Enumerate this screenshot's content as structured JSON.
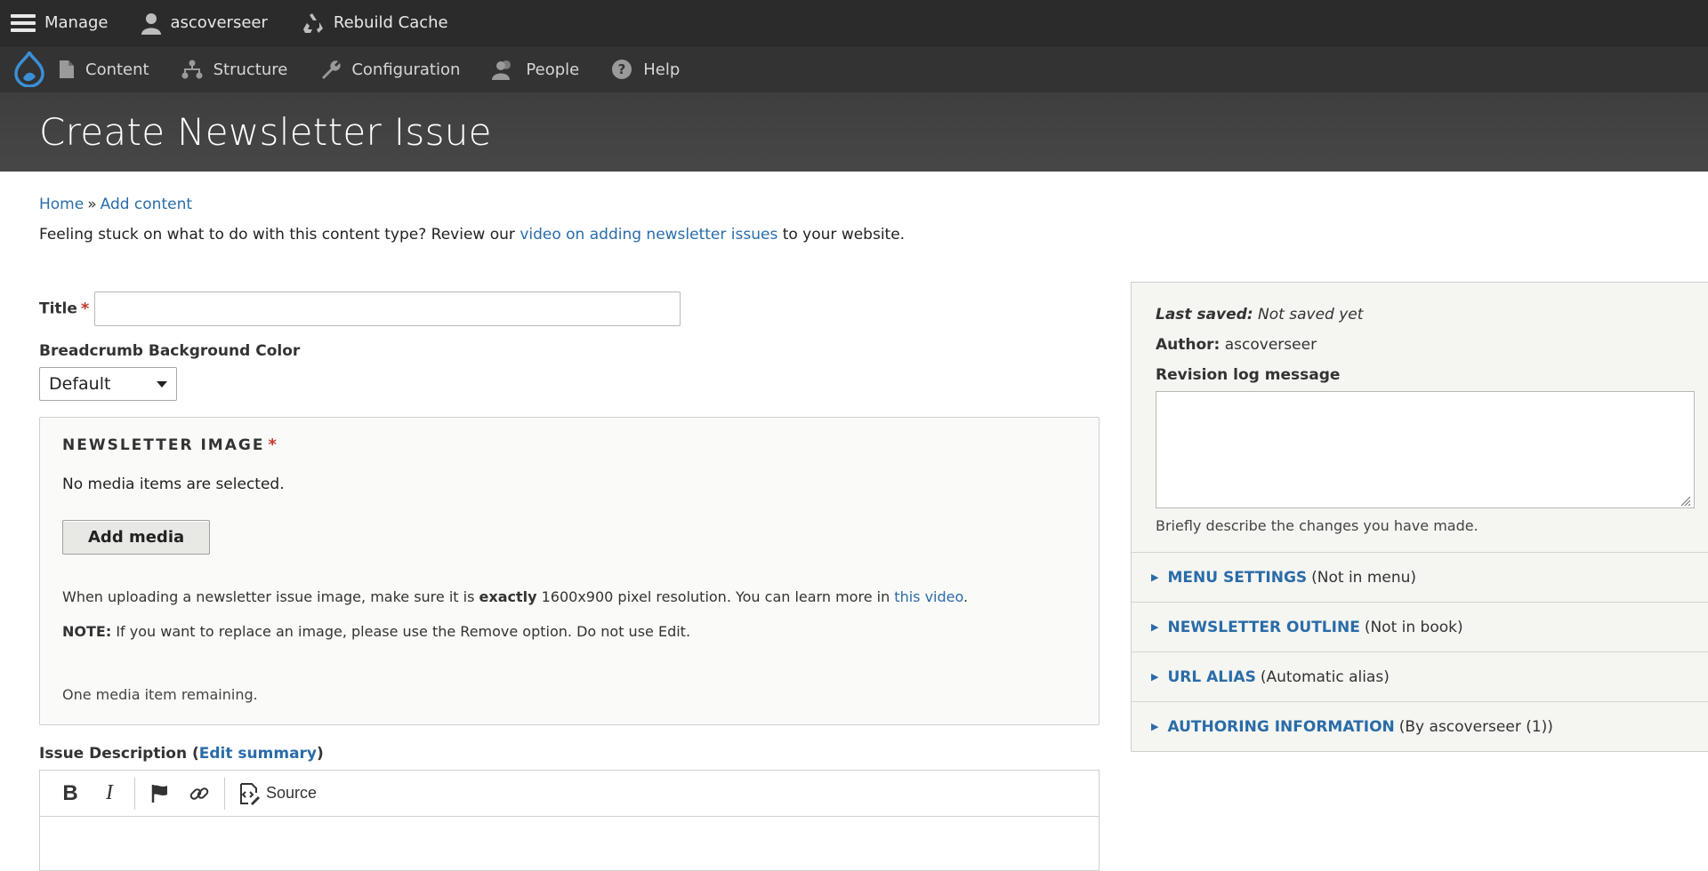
{
  "toolbar": {
    "manage": "Manage",
    "user": "ascoverseer",
    "rebuild": "Rebuild Cache"
  },
  "admin_menu": {
    "items": [
      {
        "label": "Content",
        "icon": "file-icon"
      },
      {
        "label": "Structure",
        "icon": "sitemap-icon"
      },
      {
        "label": "Configuration",
        "icon": "wrench-icon"
      },
      {
        "label": "People",
        "icon": "people-icon"
      },
      {
        "label": "Help",
        "icon": "help-icon"
      }
    ]
  },
  "page": {
    "title": "Create Newsletter Issue"
  },
  "breadcrumb": {
    "home": "Home",
    "sep": "»",
    "add_content": "Add content"
  },
  "help": {
    "before": "Feeling stuck on what to do with this content type? Review our ",
    "link": "video on adding newsletter issues",
    "after": " to your website."
  },
  "form": {
    "title_label": "Title",
    "required_mark": "*",
    "title_value": "",
    "bg_color_label": "Breadcrumb Background Color",
    "bg_color_value": "Default",
    "newsletter_image": {
      "legend": "NEWSLETTER IMAGE",
      "empty_text": "No media items are selected.",
      "add_button": "Add media",
      "desc_before": "When uploading a newsletter issue image, make sure it is ",
      "desc_bold": "exactly",
      "desc_after": " 1600x900 pixel resolution. You can learn more in ",
      "desc_link": "this video",
      "desc_end": ".",
      "note_label": "NOTE:",
      "note_text": " If you want to replace an image, please use the Remove option. Do not use Edit.",
      "remaining": "One media item remaining."
    },
    "issue_description": {
      "label": "Issue Description (",
      "edit_summary": "Edit summary",
      "close": ")",
      "toolbar": {
        "bold": "B",
        "italic": "I",
        "source": "Source"
      }
    }
  },
  "sidebar": {
    "last_saved_label": "Last saved:",
    "last_saved_value": " Not saved yet",
    "author_label": "Author:",
    "author_value": " ascoverseer",
    "revision_label": "Revision log message",
    "revision_value": "",
    "revision_desc": "Briefly describe the changes you have made.",
    "sections": [
      {
        "title": "MENU SETTINGS",
        "summary": "(Not in menu)"
      },
      {
        "title": "NEWSLETTER OUTLINE",
        "summary": "(Not in book)"
      },
      {
        "title": "URL ALIAS",
        "summary": "(Automatic alias)"
      },
      {
        "title": "AUTHORING INFORMATION",
        "summary": "(By ascoverseer (1))"
      }
    ]
  },
  "colors": {
    "link": "#2a6ca8",
    "required": "#c0392b",
    "drupal_blue": "#3b8fd6"
  }
}
